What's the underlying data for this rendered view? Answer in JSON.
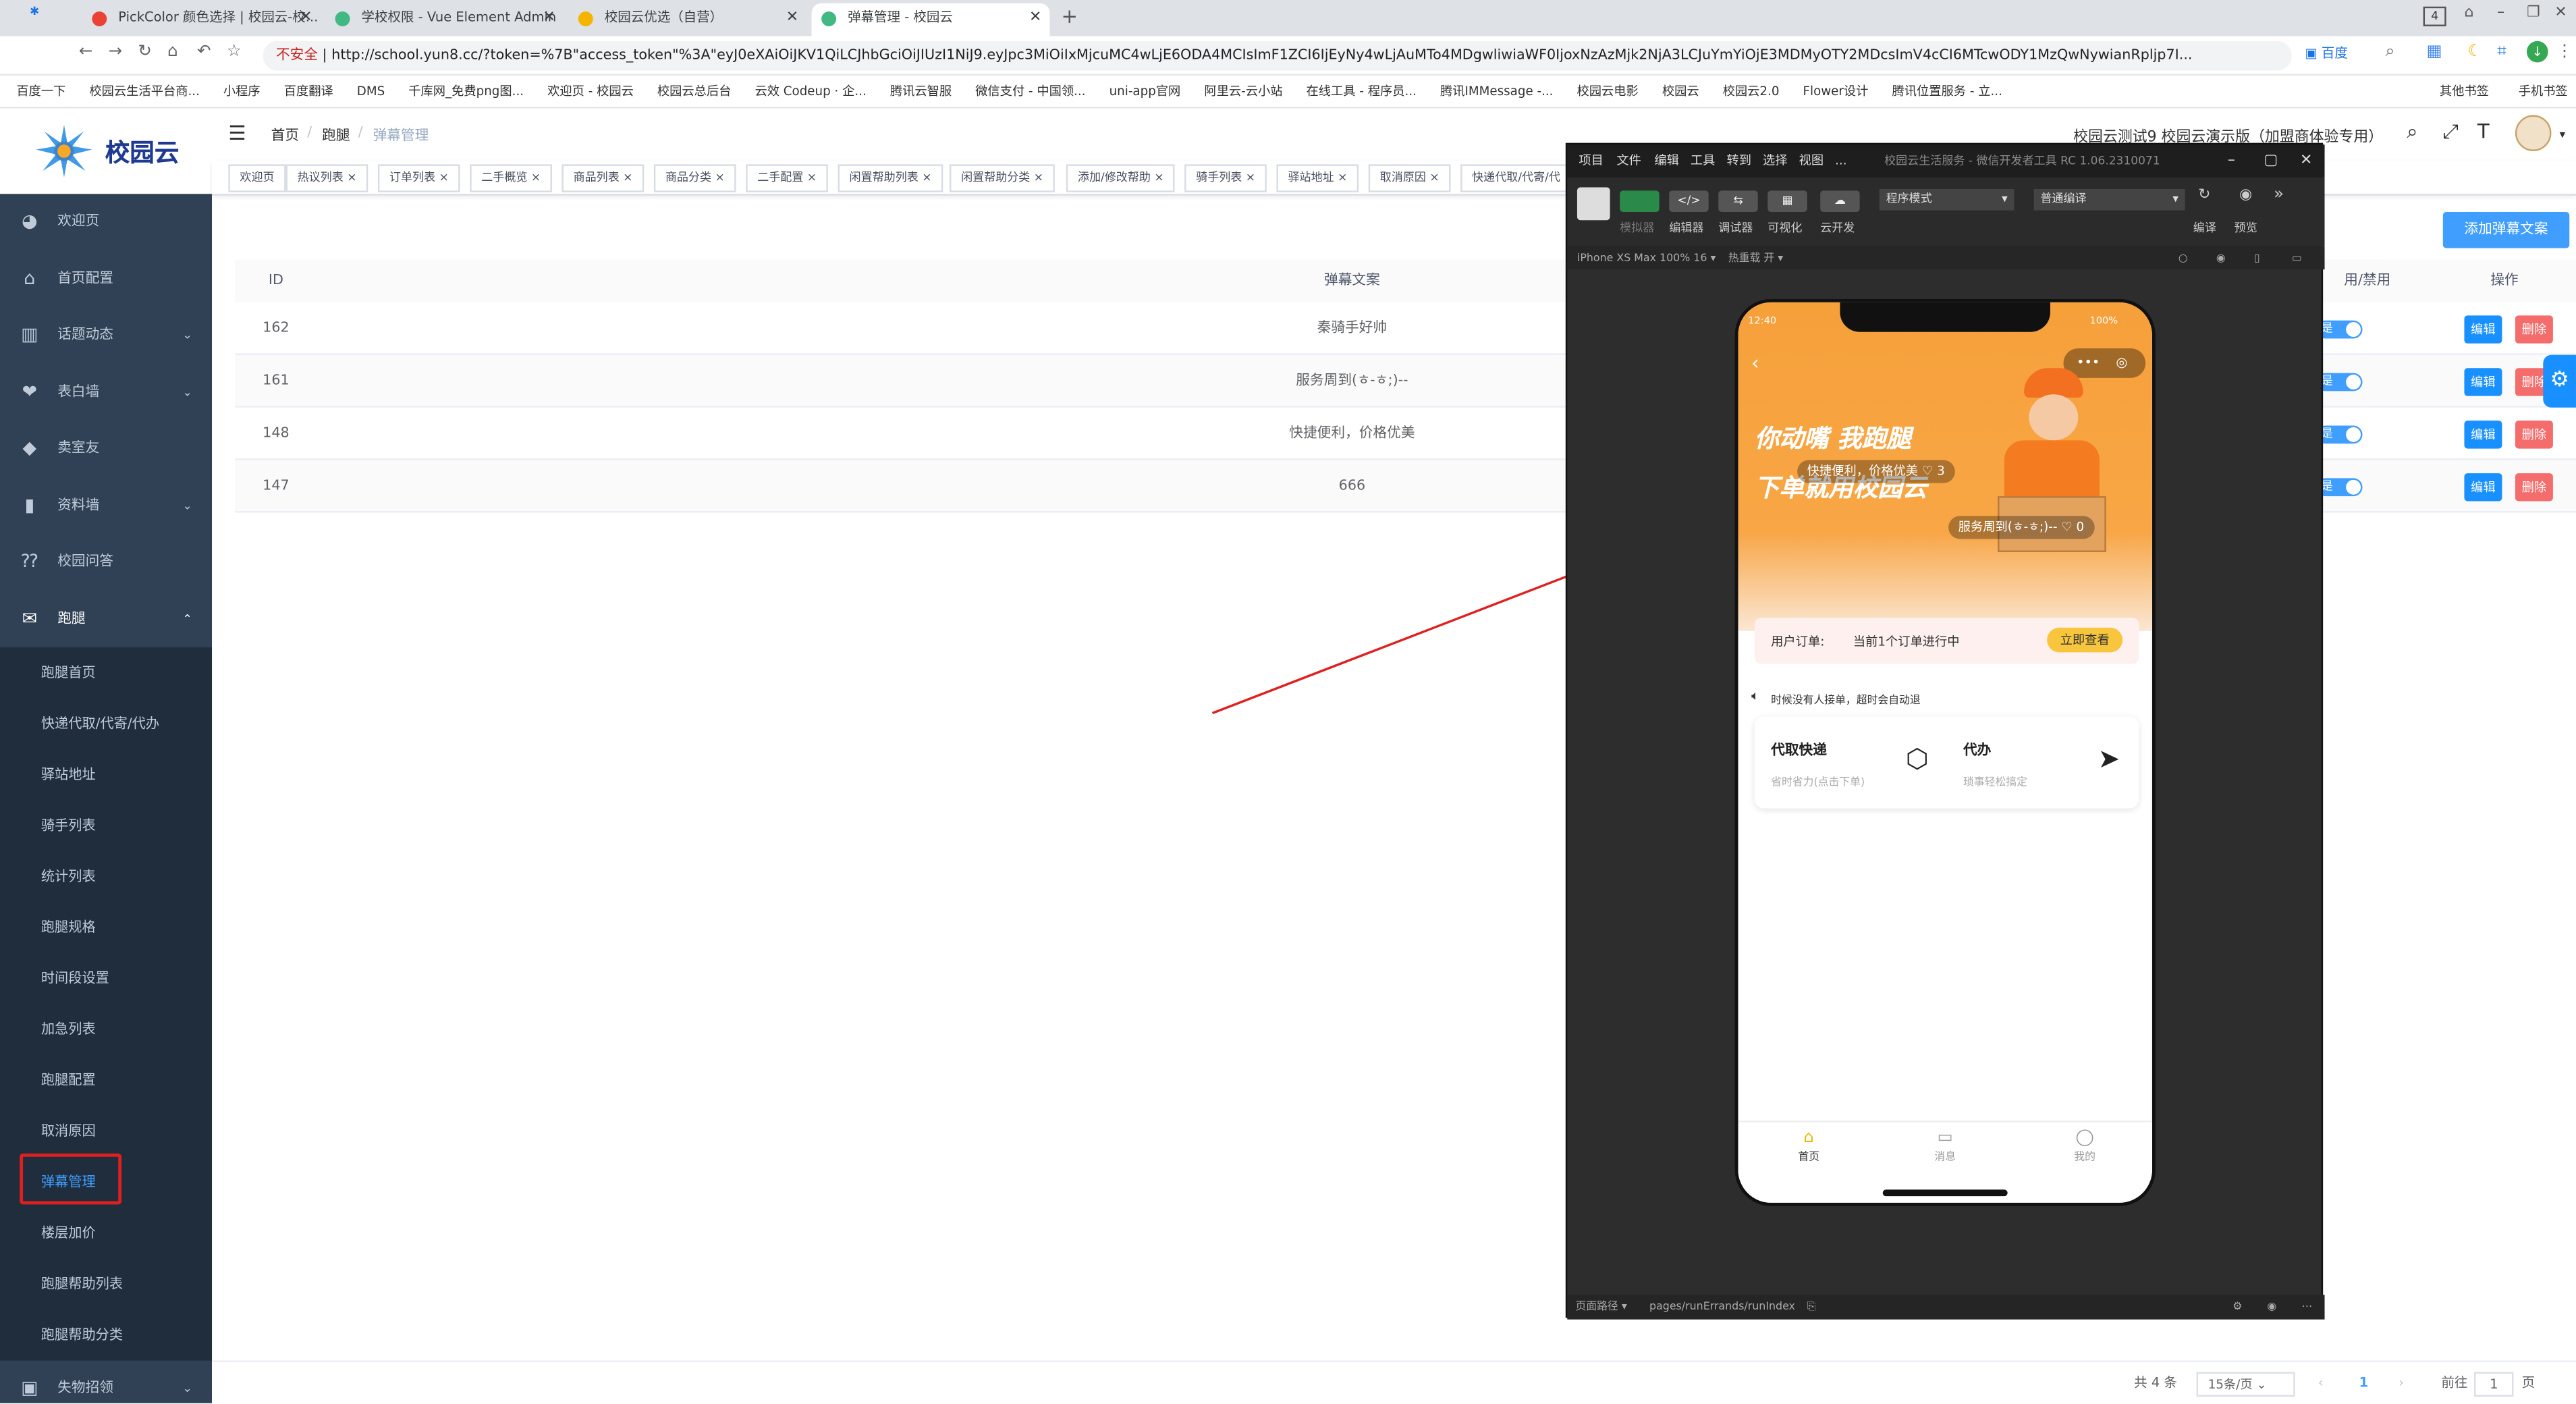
{
  "browser": {
    "tabs": [
      {
        "label": "PickColor 颜色选择 | 校园云-校..."
      },
      {
        "label": "学校权限 - Vue Element Admin"
      },
      {
        "label": "校园云优选（自营）"
      },
      {
        "label": "弹幕管理 - 校园云"
      }
    ],
    "address": {
      "security": "不安全",
      "url": "http://school.yun8.cc/?token=%7B\"access_token\"%3A\"eyJ0eXAiOiJKV1QiLCJhbGciOiJIUzI1NiJ9.eyJpc3MiOiIxMjcuMC4wLjE6ODA4MCIsImF1ZCI6IjEyNy4wLjAuMTo4MDgwliwiaWF0IjoxNzAzMjk2NjA3LCJuYmYiOjE3MDMyOTY2MDcsImV4cCI6MTcwODY1MzQwNywianRpljp7I..."
    },
    "bookmarks": [
      "百度一下",
      "校园云生活平台商...",
      "小程序",
      "百度翻译",
      "DMS",
      "千库网_免费png图...",
      "欢迎页 - 校园云",
      "校园云总后台",
      "云效 Codeup · 企...",
      "腾讯云智服",
      "微信支付 - 中国领...",
      "uni-app官网",
      "阿里云-云小站",
      "在线工具 - 程序员...",
      "腾讯IMMessage -...",
      "校园云电影",
      "校园云",
      "校园云2.0",
      "Flower设计",
      "腾讯位置服务 - 立...",
      "其他书签",
      "手机书签"
    ],
    "right_icons": {
      "count": "4",
      "baidu": "百度"
    }
  },
  "app": {
    "logo": "校园云",
    "breadcrumb": [
      "首页",
      "跑腿",
      "弹幕管理"
    ],
    "site_title": "校园云测试9 校园云演示版（加盟商体验专用）",
    "tags": [
      "欢迎页",
      "热议列表",
      "订单列表",
      "二手概览",
      "商品列表",
      "商品分类",
      "二手配置",
      "闲置帮助列表",
      "闲置帮助分类",
      "添加/修改帮助",
      "骑手列表",
      "驿站地址",
      "取消原因",
      "快递代取/代寄/代"
    ],
    "add_button": "添加弹幕文案"
  },
  "sidebar": {
    "items": [
      {
        "label": "欢迎页",
        "icon": "dashboard-icon"
      },
      {
        "label": "首页配置",
        "icon": "home-icon"
      },
      {
        "label": "话题动态",
        "icon": "book-icon"
      },
      {
        "label": "表白墙",
        "icon": "heart-icon"
      },
      {
        "label": "卖室友",
        "icon": "tag-icon"
      },
      {
        "label": "资料墙",
        "icon": "library-icon"
      },
      {
        "label": "校园问答",
        "icon": "qa-icon"
      },
      {
        "label": "跑腿",
        "icon": "chat-icon"
      }
    ],
    "sub_items": [
      "跑腿首页",
      "快递代取/代寄/代办",
      "驿站地址",
      "骑手列表",
      "统计列表",
      "跑腿规格",
      "时间段设置",
      "加急列表",
      "跑腿配置",
      "取消原因",
      "弹幕管理",
      "楼层加价",
      "跑腿帮助列表",
      "跑腿帮助分类"
    ],
    "bottom_item": {
      "label": "失物招领",
      "icon": "box-icon"
    }
  },
  "table": {
    "headers": {
      "id": "ID",
      "text": "弹幕文案",
      "status": "用/禁用",
      "ops": "操作"
    },
    "rows": [
      {
        "id": "162",
        "text": "秦骑手好帅",
        "status": "是"
      },
      {
        "id": "161",
        "text": "服务周到(ㅎ-ㅎ;)--",
        "status": "是"
      },
      {
        "id": "148",
        "text": "快捷便利，价格优美",
        "status": "是"
      },
      {
        "id": "147",
        "text": "666",
        "status": "是"
      }
    ],
    "edit_label": "编辑",
    "delete_label": "删除"
  },
  "pagination": {
    "total": "共 4 条",
    "page_size": "15条/页",
    "current": "1",
    "goto_label": "前往",
    "goto_value": "1",
    "page_unit": "页"
  },
  "devtools": {
    "menu": [
      "项目",
      "文件",
      "编辑",
      "工具",
      "转到",
      "选择",
      "视图",
      "..."
    ],
    "title": "校园云生活服务 - 微信开发者工具 RC 1.06.2310071",
    "tools": [
      "模拟器",
      "编辑器",
      "调试器",
      "可视化",
      "云开发"
    ],
    "mode": "程序模式",
    "compile": "普通编译",
    "actions": [
      "编译",
      "预览"
    ],
    "device": "iPhone XS Max 100% 16",
    "hot_reload": "热重载 开",
    "path_label": "页面路径",
    "path": "pages/runErrands/runIndex"
  },
  "phone": {
    "time": "12:40",
    "battery": "100%",
    "banner_line1": "你动嘴 我跑腿",
    "banner_line2": "下单就用校园云",
    "danmaku": [
      {
        "text": "快捷便利，价格优美",
        "likes": "3"
      },
      {
        "text": "服务周到(ㅎ-ㅎ;)--",
        "likes": "0"
      }
    ],
    "order_label": "用户订单:",
    "order_status": "当前1个订单进行中",
    "order_button": "立即查看",
    "notice": "时候没有人接单，超时会自动退",
    "services": [
      {
        "title": "代取快递",
        "desc": "省时省力(点击下单)"
      },
      {
        "title": "代办",
        "desc": "琐事轻松搞定"
      }
    ],
    "tabbar": [
      "首页",
      "消息",
      "我的"
    ]
  },
  "colors": {
    "sidebar": "#304156",
    "active": "#409eff",
    "danger": "#f56c6c",
    "highlight_box": "#e02020",
    "banner": "#f7a53a"
  }
}
